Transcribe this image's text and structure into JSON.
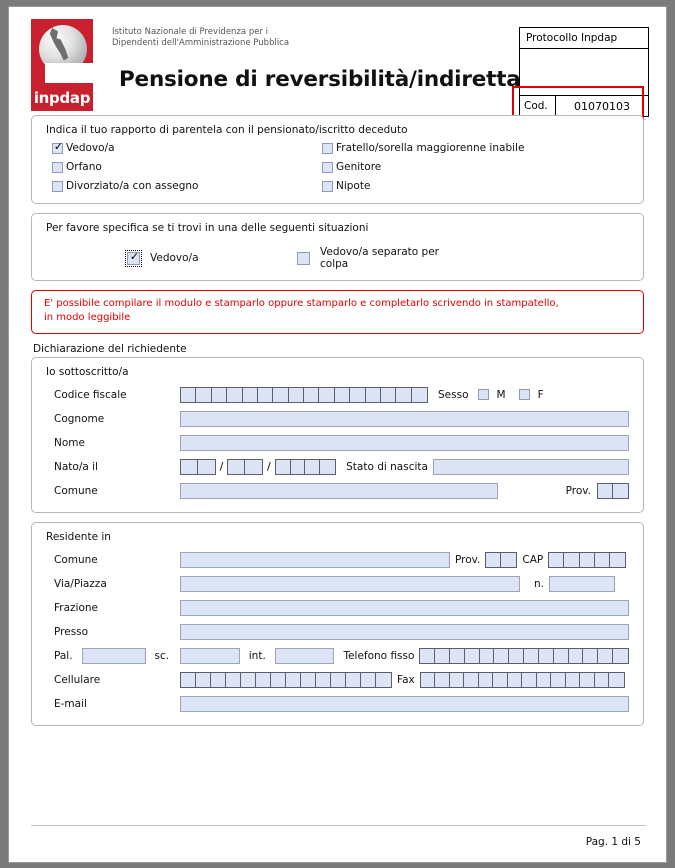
{
  "header": {
    "institution_line1": "Istituto Nazionale di Previdenza per i",
    "institution_line2": "Dipendenti dell'Amministrazione Pubblica",
    "logo_word": "inpdap",
    "title": "Pensione di reversibilità/indiretta",
    "protocol": {
      "title": "Protocollo Inpdap",
      "cod_label": "Cod.",
      "cod_value": "01070103"
    }
  },
  "relationship_section": {
    "legend": "Indica il tuo rapporto di parentela con il pensionato/iscritto deceduto",
    "options": [
      {
        "label": "Vedovo/a",
        "checked": true
      },
      {
        "label": "Fratello/sorella maggiorenne inabile",
        "checked": false
      },
      {
        "label": "Orfano",
        "checked": false
      },
      {
        "label": "Genitore",
        "checked": false
      },
      {
        "label": "Divorziato/a con assegno",
        "checked": false
      },
      {
        "label": "Nipote",
        "checked": false
      }
    ]
  },
  "situation_section": {
    "legend": "Per favore specifica se ti trovi in una delle seguenti situazioni",
    "options": [
      {
        "label": "Vedovo/a",
        "checked": true,
        "focused": true
      },
      {
        "label": "Vedovo/a separato per colpa",
        "checked": false,
        "focused": false
      }
    ]
  },
  "warning": {
    "line1": "E' possibile compilare il modulo e stamparlo oppure stamparlo e completarlo scrivendo in stampatello,",
    "line2": "in modo leggibile"
  },
  "declaration": {
    "caption": "Dichiarazione del richiedente",
    "legend": "Io sottoscritto/a",
    "fields": {
      "codice_fiscale_label": "Codice fiscale",
      "codice_fiscale_boxes": 16,
      "codice_fiscale_value": "",
      "sesso_label": "Sesso",
      "sesso_m_label": "M",
      "sesso_m_checked": false,
      "sesso_f_label": "F",
      "sesso_f_checked": false,
      "cognome_label": "Cognome",
      "cognome_value": "",
      "nome_label": "Nome",
      "nome_value": "",
      "nato_label": "Nato/a il",
      "nato_day_boxes": 2,
      "nato_month_boxes": 2,
      "nato_year_boxes": 4,
      "separator": "/",
      "stato_nascita_label": "Stato di nascita",
      "stato_nascita_value": "",
      "comune_label": "Comune",
      "comune_value": "",
      "prov_label": "Prov.",
      "prov_boxes": 2,
      "prov_value": ""
    }
  },
  "residence": {
    "legend": "Residente in",
    "fields": {
      "comune_label": "Comune",
      "comune_value": "",
      "prov_label": "Prov.",
      "prov_boxes": 2,
      "cap_label": "CAP",
      "cap_boxes": 5,
      "cap_value": "",
      "via_label": "Via/Piazza",
      "via_value": "",
      "n_label": "n.",
      "n_value": "",
      "frazione_label": "Frazione",
      "frazione_value": "",
      "presso_label": "Presso",
      "presso_value": "",
      "pal_label": "Pal.",
      "pal_value": "",
      "sc_label": "sc.",
      "sc_value": "",
      "int_label": "int.",
      "int_value": "",
      "telefono_label": "Telefono fisso",
      "telefono_boxes": 14,
      "telefono_value": "",
      "cellulare_label": "Cellulare",
      "cellulare_boxes": 14,
      "cellulare_value": "",
      "fax_label": "Fax",
      "fax_boxes": 14,
      "fax_value": "",
      "email_label": "E-mail",
      "email_value": ""
    }
  },
  "footer": {
    "page_text": "Pag. 1 di 5"
  },
  "colors": {
    "brand_red": "#c8202e",
    "annotation_red": "#e10000",
    "field_fill": "#dce4f5",
    "field_border": "#9aa5bd",
    "panel_border": "#b7b7b7"
  }
}
